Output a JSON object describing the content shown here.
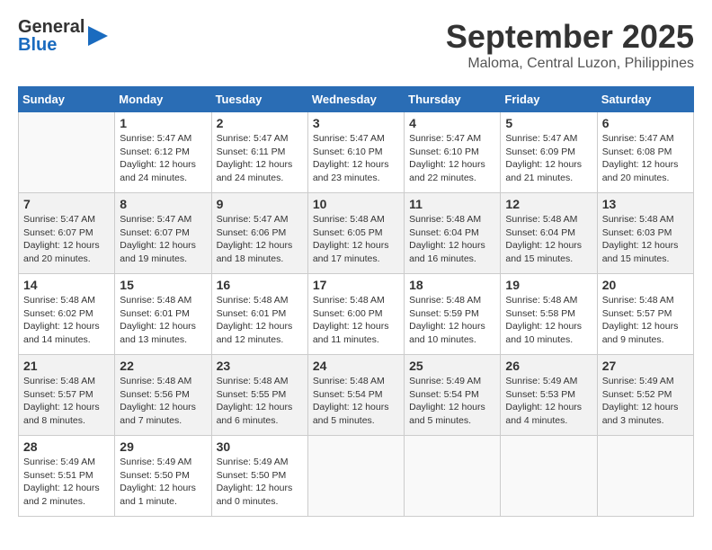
{
  "header": {
    "logo_general": "General",
    "logo_blue": "Blue",
    "title": "September 2025",
    "subtitle": "Maloma, Central Luzon, Philippines"
  },
  "weekdays": [
    "Sunday",
    "Monday",
    "Tuesday",
    "Wednesday",
    "Thursday",
    "Friday",
    "Saturday"
  ],
  "weeks": [
    [
      {
        "day": "",
        "sunrise": "",
        "sunset": "",
        "daylight": ""
      },
      {
        "day": "1",
        "sunrise": "Sunrise: 5:47 AM",
        "sunset": "Sunset: 6:12 PM",
        "daylight": "Daylight: 12 hours and 24 minutes."
      },
      {
        "day": "2",
        "sunrise": "Sunrise: 5:47 AM",
        "sunset": "Sunset: 6:11 PM",
        "daylight": "Daylight: 12 hours and 24 minutes."
      },
      {
        "day": "3",
        "sunrise": "Sunrise: 5:47 AM",
        "sunset": "Sunset: 6:10 PM",
        "daylight": "Daylight: 12 hours and 23 minutes."
      },
      {
        "day": "4",
        "sunrise": "Sunrise: 5:47 AM",
        "sunset": "Sunset: 6:10 PM",
        "daylight": "Daylight: 12 hours and 22 minutes."
      },
      {
        "day": "5",
        "sunrise": "Sunrise: 5:47 AM",
        "sunset": "Sunset: 6:09 PM",
        "daylight": "Daylight: 12 hours and 21 minutes."
      },
      {
        "day": "6",
        "sunrise": "Sunrise: 5:47 AM",
        "sunset": "Sunset: 6:08 PM",
        "daylight": "Daylight: 12 hours and 20 minutes."
      }
    ],
    [
      {
        "day": "7",
        "sunrise": "Sunrise: 5:47 AM",
        "sunset": "Sunset: 6:07 PM",
        "daylight": "Daylight: 12 hours and 20 minutes."
      },
      {
        "day": "8",
        "sunrise": "Sunrise: 5:47 AM",
        "sunset": "Sunset: 6:07 PM",
        "daylight": "Daylight: 12 hours and 19 minutes."
      },
      {
        "day": "9",
        "sunrise": "Sunrise: 5:47 AM",
        "sunset": "Sunset: 6:06 PM",
        "daylight": "Daylight: 12 hours and 18 minutes."
      },
      {
        "day": "10",
        "sunrise": "Sunrise: 5:48 AM",
        "sunset": "Sunset: 6:05 PM",
        "daylight": "Daylight: 12 hours and 17 minutes."
      },
      {
        "day": "11",
        "sunrise": "Sunrise: 5:48 AM",
        "sunset": "Sunset: 6:04 PM",
        "daylight": "Daylight: 12 hours and 16 minutes."
      },
      {
        "day": "12",
        "sunrise": "Sunrise: 5:48 AM",
        "sunset": "Sunset: 6:04 PM",
        "daylight": "Daylight: 12 hours and 15 minutes."
      },
      {
        "day": "13",
        "sunrise": "Sunrise: 5:48 AM",
        "sunset": "Sunset: 6:03 PM",
        "daylight": "Daylight: 12 hours and 15 minutes."
      }
    ],
    [
      {
        "day": "14",
        "sunrise": "Sunrise: 5:48 AM",
        "sunset": "Sunset: 6:02 PM",
        "daylight": "Daylight: 12 hours and 14 minutes."
      },
      {
        "day": "15",
        "sunrise": "Sunrise: 5:48 AM",
        "sunset": "Sunset: 6:01 PM",
        "daylight": "Daylight: 12 hours and 13 minutes."
      },
      {
        "day": "16",
        "sunrise": "Sunrise: 5:48 AM",
        "sunset": "Sunset: 6:01 PM",
        "daylight": "Daylight: 12 hours and 12 minutes."
      },
      {
        "day": "17",
        "sunrise": "Sunrise: 5:48 AM",
        "sunset": "Sunset: 6:00 PM",
        "daylight": "Daylight: 12 hours and 11 minutes."
      },
      {
        "day": "18",
        "sunrise": "Sunrise: 5:48 AM",
        "sunset": "Sunset: 5:59 PM",
        "daylight": "Daylight: 12 hours and 10 minutes."
      },
      {
        "day": "19",
        "sunrise": "Sunrise: 5:48 AM",
        "sunset": "Sunset: 5:58 PM",
        "daylight": "Daylight: 12 hours and 10 minutes."
      },
      {
        "day": "20",
        "sunrise": "Sunrise: 5:48 AM",
        "sunset": "Sunset: 5:57 PM",
        "daylight": "Daylight: 12 hours and 9 minutes."
      }
    ],
    [
      {
        "day": "21",
        "sunrise": "Sunrise: 5:48 AM",
        "sunset": "Sunset: 5:57 PM",
        "daylight": "Daylight: 12 hours and 8 minutes."
      },
      {
        "day": "22",
        "sunrise": "Sunrise: 5:48 AM",
        "sunset": "Sunset: 5:56 PM",
        "daylight": "Daylight: 12 hours and 7 minutes."
      },
      {
        "day": "23",
        "sunrise": "Sunrise: 5:48 AM",
        "sunset": "Sunset: 5:55 PM",
        "daylight": "Daylight: 12 hours and 6 minutes."
      },
      {
        "day": "24",
        "sunrise": "Sunrise: 5:48 AM",
        "sunset": "Sunset: 5:54 PM",
        "daylight": "Daylight: 12 hours and 5 minutes."
      },
      {
        "day": "25",
        "sunrise": "Sunrise: 5:49 AM",
        "sunset": "Sunset: 5:54 PM",
        "daylight": "Daylight: 12 hours and 5 minutes."
      },
      {
        "day": "26",
        "sunrise": "Sunrise: 5:49 AM",
        "sunset": "Sunset: 5:53 PM",
        "daylight": "Daylight: 12 hours and 4 minutes."
      },
      {
        "day": "27",
        "sunrise": "Sunrise: 5:49 AM",
        "sunset": "Sunset: 5:52 PM",
        "daylight": "Daylight: 12 hours and 3 minutes."
      }
    ],
    [
      {
        "day": "28",
        "sunrise": "Sunrise: 5:49 AM",
        "sunset": "Sunset: 5:51 PM",
        "daylight": "Daylight: 12 hours and 2 minutes."
      },
      {
        "day": "29",
        "sunrise": "Sunrise: 5:49 AM",
        "sunset": "Sunset: 5:50 PM",
        "daylight": "Daylight: 12 hours and 1 minute."
      },
      {
        "day": "30",
        "sunrise": "Sunrise: 5:49 AM",
        "sunset": "Sunset: 5:50 PM",
        "daylight": "Daylight: 12 hours and 0 minutes."
      },
      {
        "day": "",
        "sunrise": "",
        "sunset": "",
        "daylight": ""
      },
      {
        "day": "",
        "sunrise": "",
        "sunset": "",
        "daylight": ""
      },
      {
        "day": "",
        "sunrise": "",
        "sunset": "",
        "daylight": ""
      },
      {
        "day": "",
        "sunrise": "",
        "sunset": "",
        "daylight": ""
      }
    ]
  ]
}
